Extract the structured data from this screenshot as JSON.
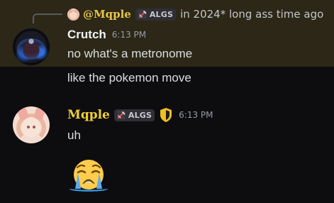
{
  "reply": {
    "username": "@Mqple",
    "tag": "ALGS",
    "text": "in 2024* long ass time ago"
  },
  "message1": {
    "author": "Crutch",
    "timestamp": "6:13 PM",
    "lines": [
      "no what's a metronome",
      "like the pokemon move"
    ]
  },
  "message2": {
    "author": "Mqple",
    "tag": "ALGS",
    "timestamp": "6:13 PM",
    "text": "uh",
    "emoji": "loudly-crying-face"
  },
  "colors": {
    "highlight_bg": "#2c2717",
    "page_bg": "#0d0d10",
    "mqple_name": "#f0d030",
    "reply_name": "#e6c64a"
  }
}
